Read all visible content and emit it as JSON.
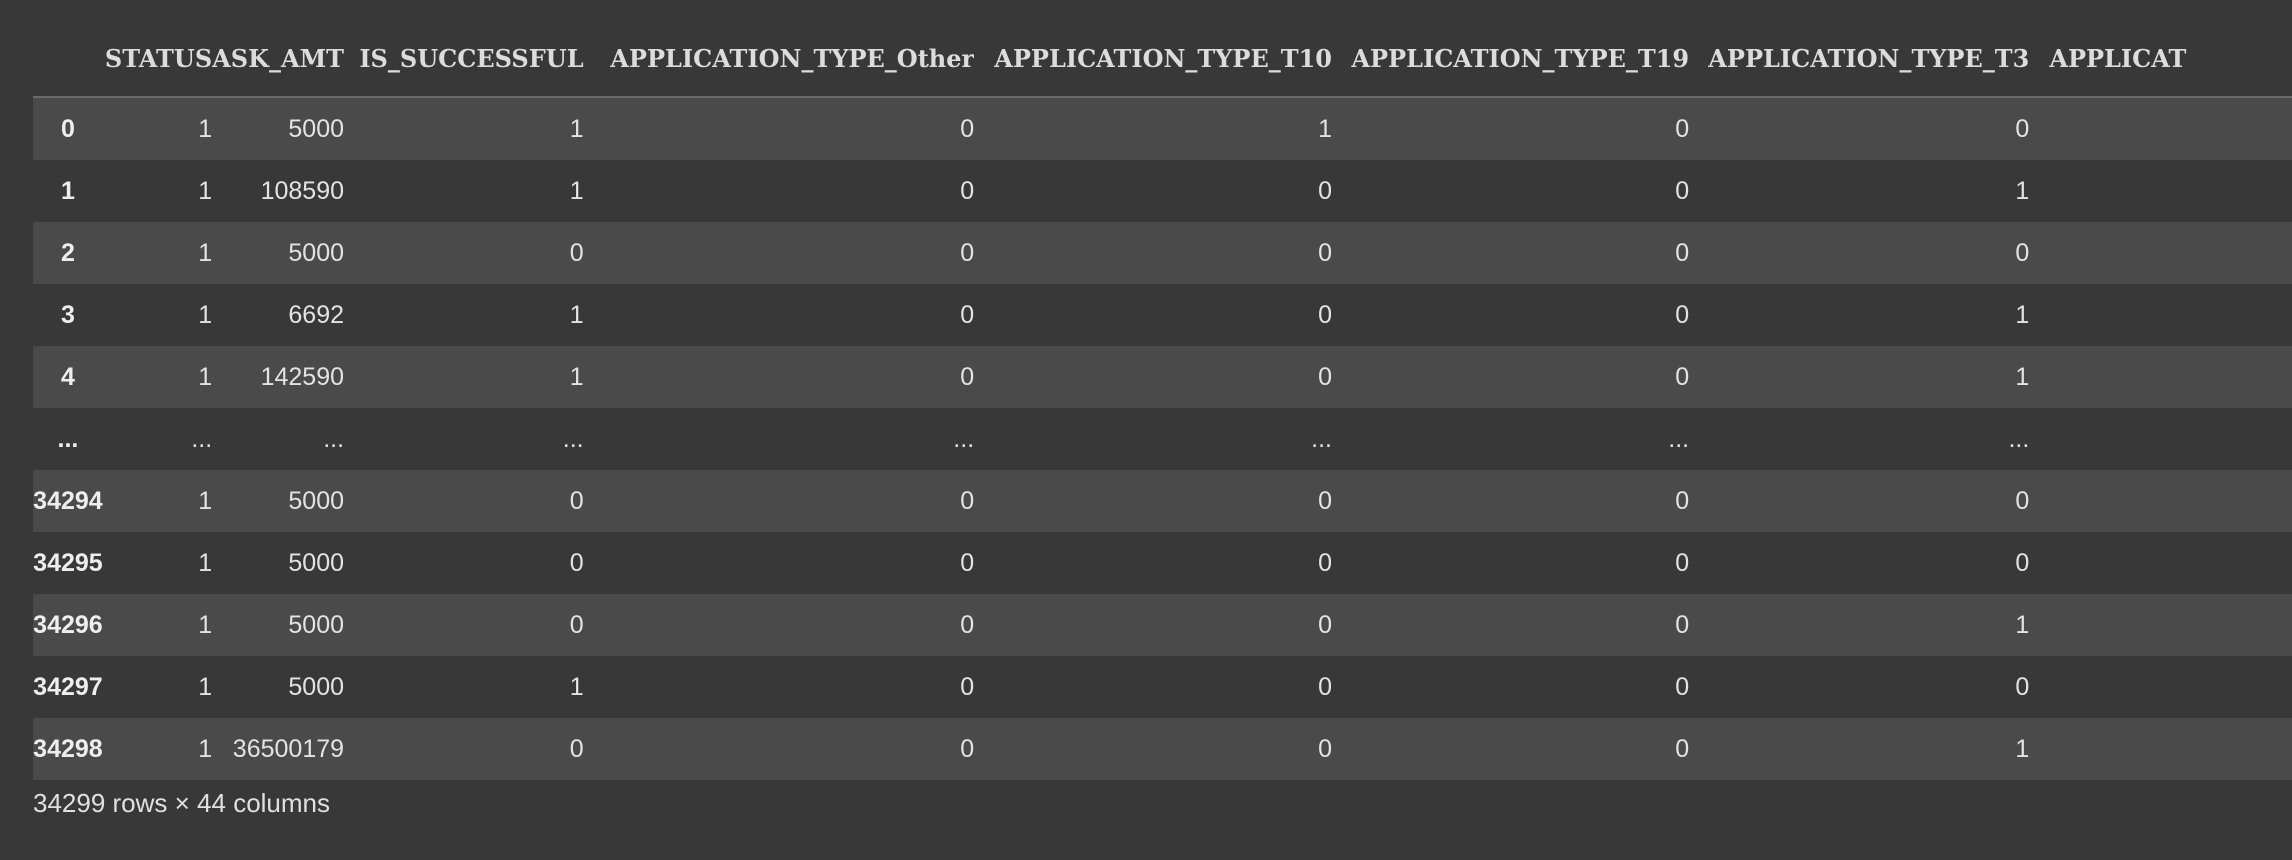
{
  "table": {
    "columns": [
      "STATUS",
      "ASK_AMT",
      "IS_SUCCESSFUL",
      "APPLICATION_TYPE_Other",
      "APPLICATION_TYPE_T10",
      "APPLICATION_TYPE_T19",
      "APPLICATION_TYPE_T3",
      "APPLICAT"
    ],
    "index": [
      "0",
      "1",
      "2",
      "3",
      "4",
      "...",
      "34294",
      "34295",
      "34296",
      "34297",
      "34298"
    ],
    "rows": [
      [
        "1",
        "5000",
        "1",
        "0",
        "1",
        "0",
        "0",
        ""
      ],
      [
        "1",
        "108590",
        "1",
        "0",
        "0",
        "0",
        "1",
        ""
      ],
      [
        "1",
        "5000",
        "0",
        "0",
        "0",
        "0",
        "0",
        ""
      ],
      [
        "1",
        "6692",
        "1",
        "0",
        "0",
        "0",
        "1",
        ""
      ],
      [
        "1",
        "142590",
        "1",
        "0",
        "0",
        "0",
        "1",
        ""
      ],
      [
        "...",
        "...",
        "...",
        "...",
        "...",
        "...",
        "...",
        ""
      ],
      [
        "1",
        "5000",
        "0",
        "0",
        "0",
        "0",
        "0",
        ""
      ],
      [
        "1",
        "5000",
        "0",
        "0",
        "0",
        "0",
        "0",
        ""
      ],
      [
        "1",
        "5000",
        "0",
        "0",
        "0",
        "0",
        "1",
        ""
      ],
      [
        "1",
        "5000",
        "1",
        "0",
        "0",
        "0",
        "0",
        ""
      ],
      [
        "1",
        "36500179",
        "0",
        "0",
        "0",
        "0",
        "1",
        ""
      ]
    ]
  },
  "footer": {
    "shape_text": "34299 rows × 44 columns"
  }
}
